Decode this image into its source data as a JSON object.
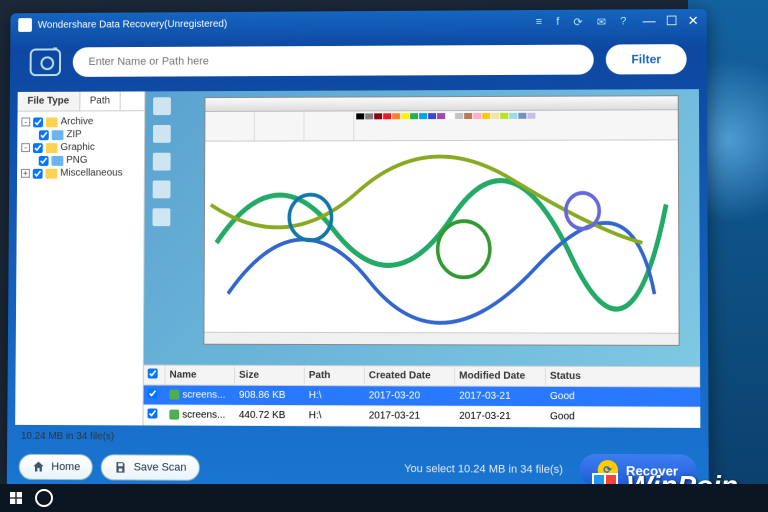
{
  "titlebar": {
    "title": "Wondershare Data Recovery(Unregistered)"
  },
  "search": {
    "placeholder": "Enter Name or Path here",
    "filter_label": "Filter"
  },
  "sidebar": {
    "tabs": {
      "file_type": "File Type",
      "path": "Path"
    },
    "tree": {
      "archive": "Archive",
      "zip": "ZIP",
      "graphic": "Graphic",
      "png": "PNG",
      "misc": "Miscellaneous"
    }
  },
  "table": {
    "headers": {
      "name": "Name",
      "size": "Size",
      "path": "Path",
      "created": "Created Date",
      "modified": "Modified Date",
      "status": "Status"
    },
    "rows": [
      {
        "name": "screens...",
        "size": "908.86 KB",
        "path": "H:\\",
        "created": "2017-03-20",
        "modified": "2017-03-21",
        "status": "Good"
      },
      {
        "name": "screens...",
        "size": "440.72 KB",
        "path": "H:\\",
        "created": "2017-03-21",
        "modified": "2017-03-21",
        "status": "Good"
      }
    ]
  },
  "status": {
    "summary": "10.24 MB in 34 file(s)"
  },
  "footer": {
    "home": "Home",
    "save_scan": "Save Scan",
    "selection": "You select 10.24 MB in 34 file(s)",
    "recover": "Recover"
  },
  "watermark": "WinPoin",
  "colors": {
    "selection": "#2979ff",
    "header_blue": "#0d47a1",
    "recover_btn": "#1e5bd6"
  },
  "palette": [
    "#000",
    "#7f7f7f",
    "#880015",
    "#ed1c24",
    "#ff7f27",
    "#fff200",
    "#22b14c",
    "#00a2e8",
    "#3f48cc",
    "#a349a4",
    "#fff",
    "#c3c3c3",
    "#b97a57",
    "#ffaec9",
    "#ffc90e",
    "#efe4b0",
    "#b5e61d",
    "#99d9ea",
    "#7092be",
    "#c8bfe7"
  ]
}
